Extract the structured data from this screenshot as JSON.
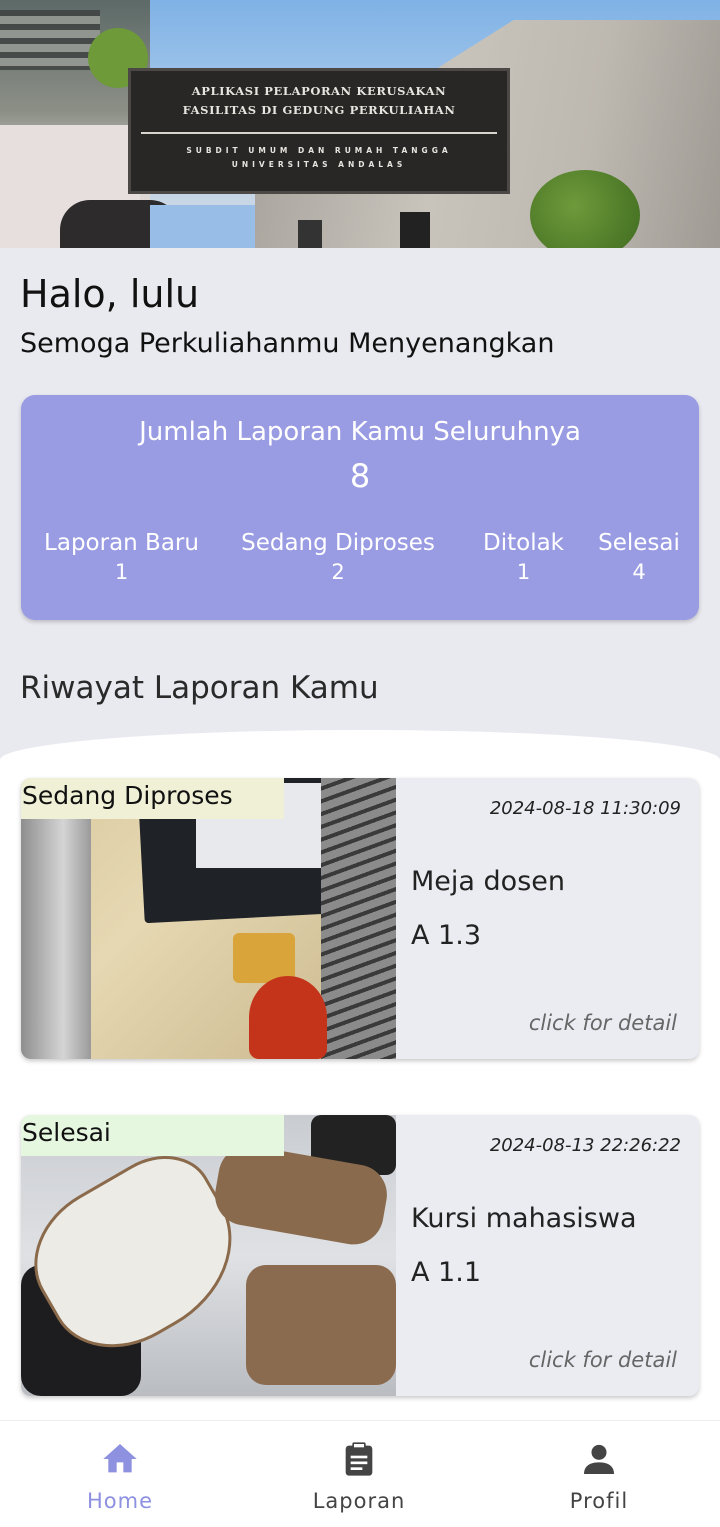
{
  "banner": {
    "title_line1": "APLIKASI PELAPORAN KERUSAKAN",
    "title_line2": "FASILITAS DI GEDUNG PERKULIAHAN",
    "subtitle_line1": "SUBDIT UMUM DAN RUMAH TANGGA",
    "subtitle_line2": "UNIVERSITAS ANDALAS"
  },
  "greeting": "Halo, lulu",
  "subtitle": "Semoga Perkuliahanmu Menyenangkan",
  "stats": {
    "title": "Jumlah Laporan Kamu Seluruhnya",
    "total": "8",
    "items": [
      {
        "label": "Laporan Baru",
        "value": "1"
      },
      {
        "label": "Sedang Diproses",
        "value": "2"
      },
      {
        "label": "Ditolak",
        "value": "1"
      },
      {
        "label": "Selesai",
        "value": "4"
      }
    ]
  },
  "history_title": "Riwayat Laporan Kamu",
  "reports": [
    {
      "status": "Sedang Diproses",
      "datetime": "2024-08-18 11:30:09",
      "item": "Meja dosen",
      "room": "A 1.3",
      "detail": "click for detail"
    },
    {
      "status": "Selesai",
      "datetime": "2024-08-13 22:26:22",
      "item": "Kursi mahasiswa",
      "room": "A 1.1",
      "detail": "click for detail"
    }
  ],
  "nav": {
    "home": {
      "label": "Home",
      "icon": "home-icon"
    },
    "laporan": {
      "label": "Laporan",
      "icon": "clipboard-icon"
    },
    "profil": {
      "label": "Profil",
      "icon": "person-icon"
    }
  },
  "colors": {
    "accent": "#9a9ce3",
    "nav_active": "#8e90e0",
    "status_processing_bg": "#f0f0d6",
    "status_done_bg": "#e6f7e0"
  }
}
